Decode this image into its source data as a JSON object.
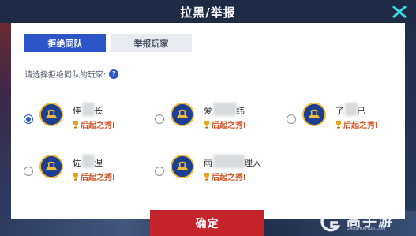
{
  "header": {
    "title": "拉黑/举报"
  },
  "tabs": [
    {
      "label": "拒绝同队",
      "active": true
    },
    {
      "label": "举报玩家",
      "active": false
    }
  ],
  "prompt": {
    "text": "请选择拒绝同队的玩家:",
    "help_symbol": "?"
  },
  "players": [
    {
      "name_start": "佳",
      "name_end": "长",
      "badge": "后起之秀Ⅰ",
      "checked": true
    },
    {
      "name_start": "爱",
      "name_end": "纬",
      "badge": "后起之秀Ⅰ",
      "checked": false
    },
    {
      "name_start": "了",
      "name_end": "已",
      "badge": "后起之秀Ⅰ",
      "checked": false
    },
    {
      "name_start": "佐",
      "name_end": "涅",
      "badge": "后起之秀Ⅰ",
      "checked": false
    },
    {
      "name_start": "雨",
      "name_end": "理人",
      "badge": "后起之秀Ⅰ",
      "checked": false
    }
  ],
  "footer": {
    "confirm_label": "确定"
  },
  "watermark": {
    "text": "高手游",
    "subtext": "GAOSHOUYOU.COM"
  },
  "colors": {
    "accent": "#2c56c8",
    "confirm": "#c4242a",
    "badge": "#d2572b",
    "header": "#1f2b45"
  }
}
